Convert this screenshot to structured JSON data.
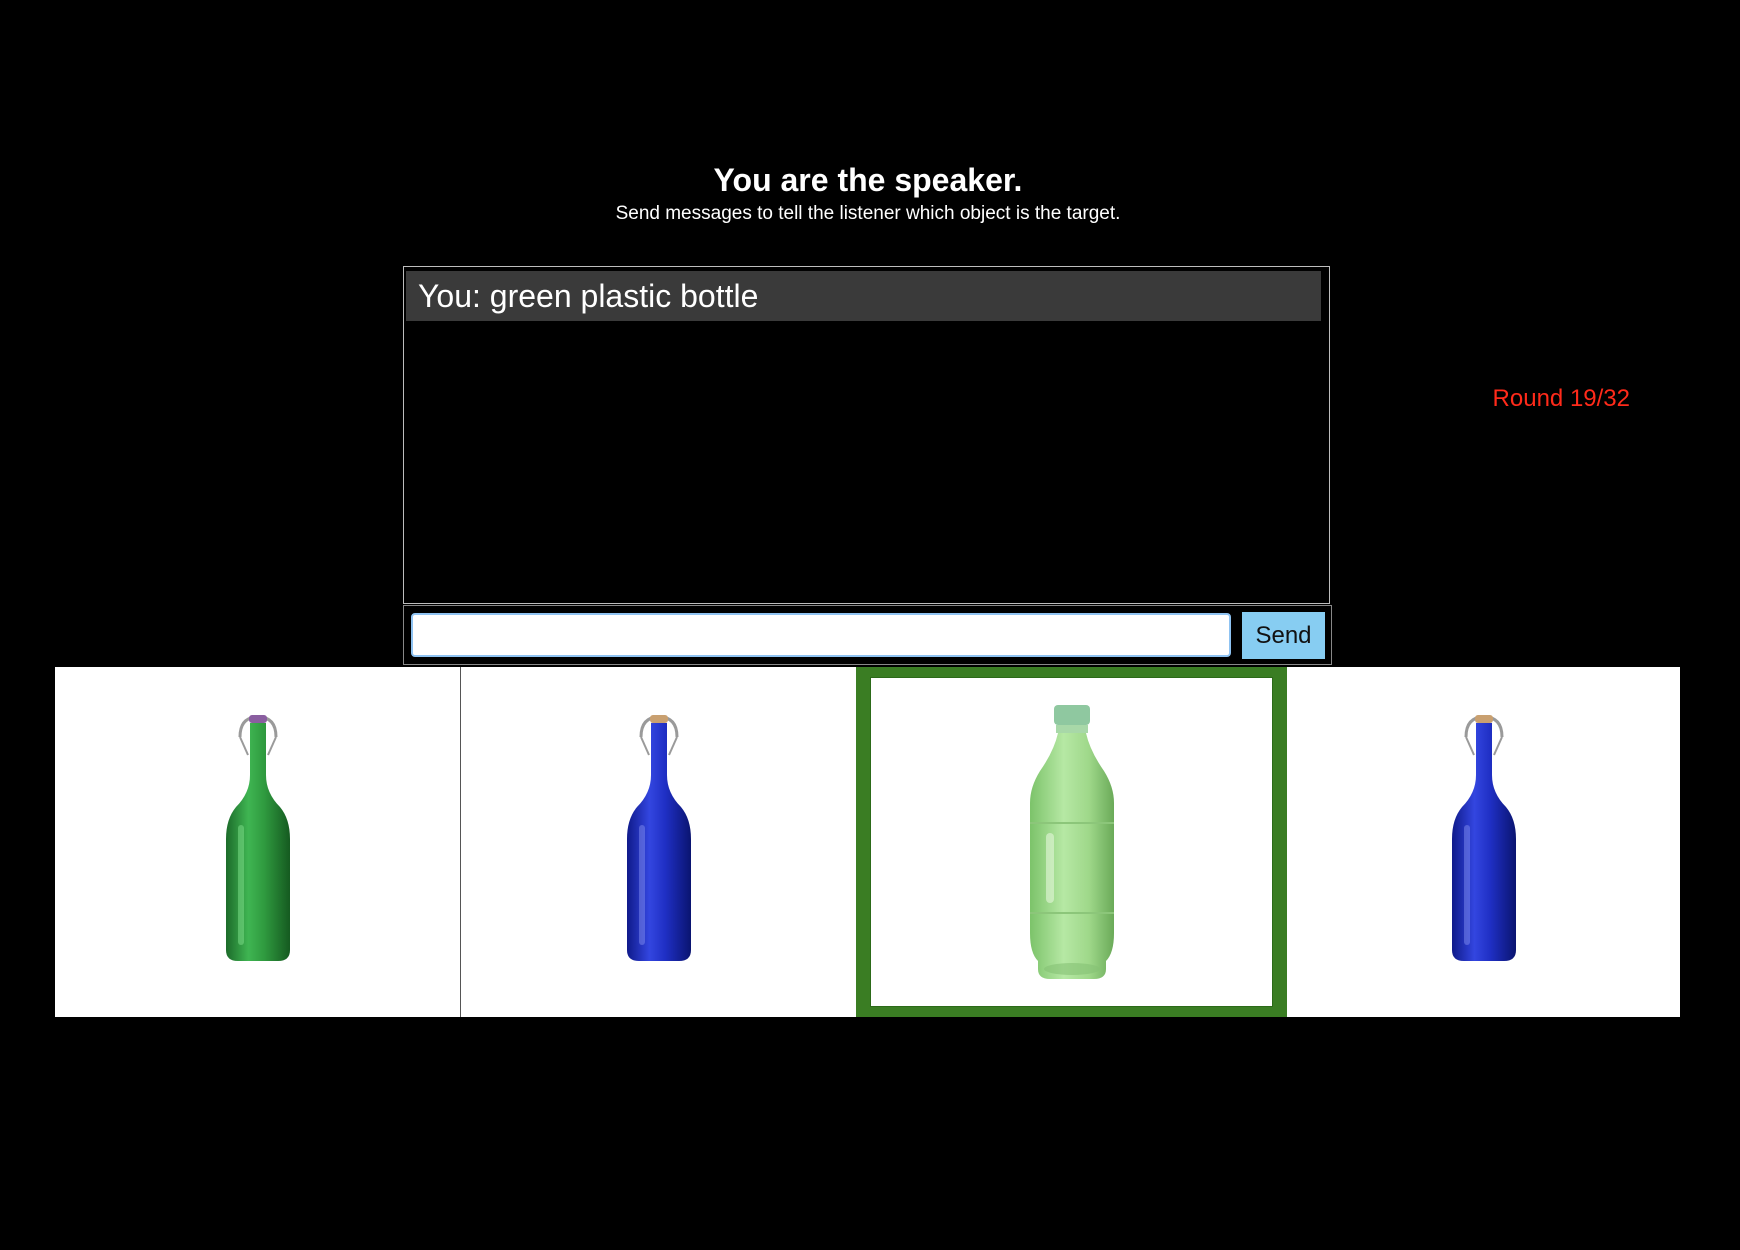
{
  "header": {
    "title": "You are the speaker.",
    "subtitle": "Send messages to tell the listener which object is the target."
  },
  "round": {
    "label": "Round 19/32"
  },
  "chat": {
    "messages": [
      {
        "text": "You: green plastic bottle"
      }
    ],
    "input": {
      "value": "",
      "placeholder": ""
    },
    "send_label": "Send"
  },
  "objects": [
    {
      "kind": "glass-swing-top-bottle",
      "color": "#2f9a3f",
      "target": false
    },
    {
      "kind": "glass-swing-top-bottle",
      "color": "#1f2fc4",
      "target": false
    },
    {
      "kind": "plastic-bottle",
      "color": "#9fd88a",
      "target": true
    },
    {
      "kind": "glass-swing-top-bottle",
      "color": "#1f2fc4",
      "target": false
    }
  ],
  "colors": {
    "target_border": "#3a7d23",
    "round_text": "#ff2a1a",
    "send_button": "#87cdf2",
    "message_background": "#3a3a3a"
  }
}
